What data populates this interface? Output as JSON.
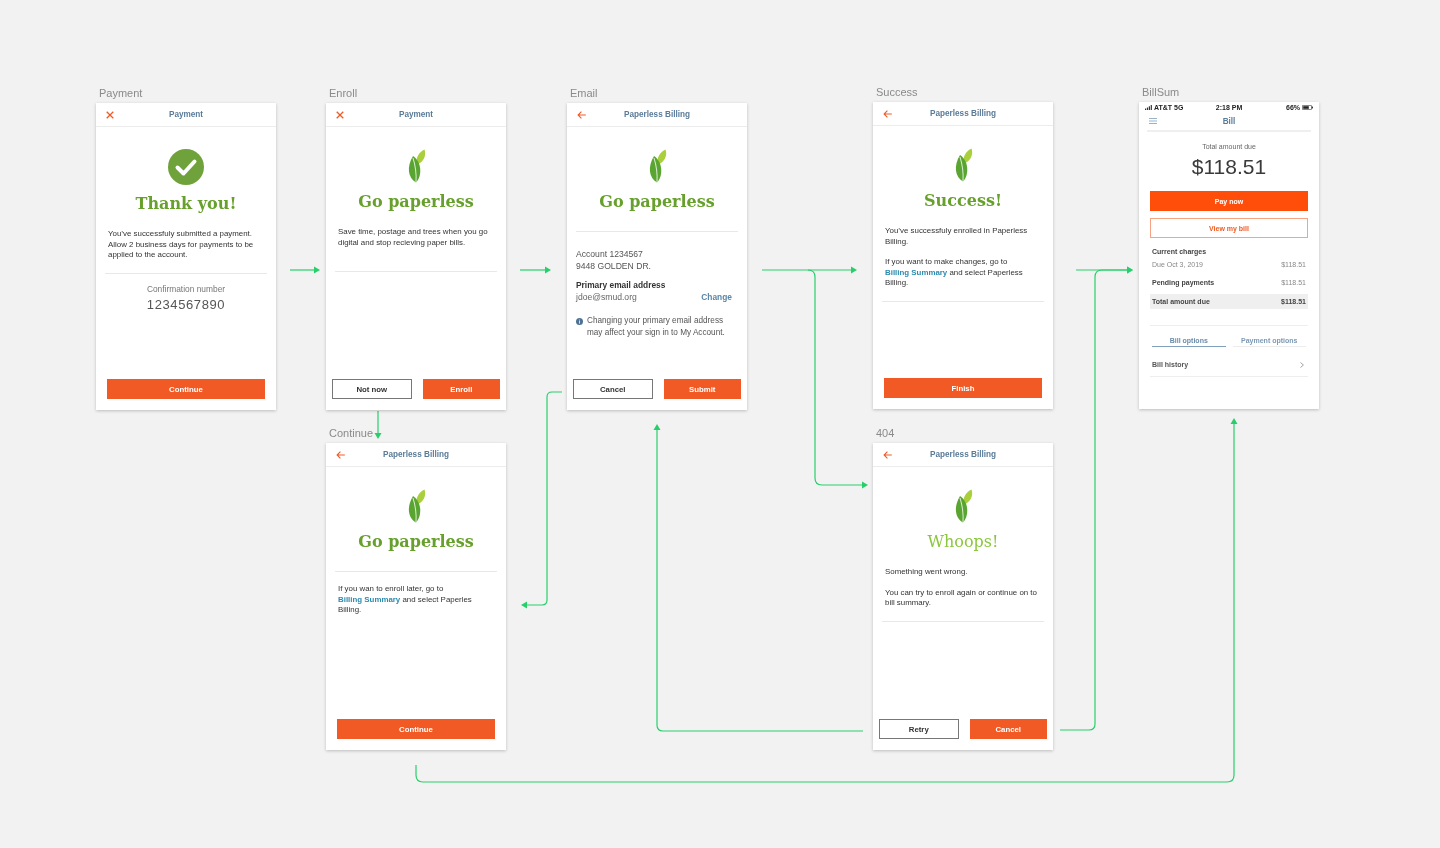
{
  "screens": [
    {
      "label": "Payment",
      "kind": "flow",
      "nav": {
        "kind": "close",
        "title": "Payment"
      },
      "hero": {
        "kind": "confirmation",
        "heading": "Thank you!",
        "error": false
      },
      "top": [
        {
          "kind": "paragraph",
          "text": "You’ve successfuly submitted a payment. Allow 2 business days for payments to be applied to the account."
        }
      ],
      "bottom": [
        {
          "kind": "stat",
          "label": "Confirmation number",
          "value": "1234567890"
        }
      ],
      "buttons": [
        {
          "label": "Continue",
          "kind": "primary"
        }
      ]
    },
    {
      "label": "Enroll",
      "kind": "flow",
      "nav": {
        "kind": "close",
        "title": "Payment"
      },
      "hero": {
        "kind": "brand",
        "heading": "Go paperless",
        "error": false
      },
      "top": [
        {
          "kind": "paragraph",
          "text": "Save time, postage and trees when you go digital and stop recieving paper bills."
        }
      ],
      "buttons": [
        {
          "label": "Not now",
          "kind": "secondary"
        },
        {
          "label": "Enroll",
          "kind": "primary"
        }
      ]
    },
    {
      "label": "Email",
      "kind": "flow",
      "nav": {
        "kind": "back",
        "title": "Paperless Billing"
      },
      "hero": {
        "kind": "brand",
        "heading": "Go paperless",
        "error": false
      },
      "bottom": [
        {
          "kind": "lines",
          "lines": [
            "Account 1234567",
            "9448 GOLDEN DR."
          ]
        },
        {
          "kind": "field",
          "label": "Primary email address",
          "value": "jdoe@smud.org",
          "action": "Change"
        },
        {
          "kind": "note",
          "text": "Changing your primary email address may affect your sign in to My Account."
        }
      ],
      "buttons": [
        {
          "label": "Cancel",
          "kind": "secondary"
        },
        {
          "label": "Submit",
          "kind": "primary"
        }
      ]
    },
    {
      "label": "Success",
      "kind": "flow",
      "nav": {
        "kind": "back",
        "title": "Paperless Billing"
      },
      "hero": {
        "kind": "brand",
        "heading": "Success!",
        "error": false
      },
      "top": [
        {
          "kind": "paragraph",
          "text": "You’ve successfuly enrolled in Paperless Billing."
        },
        {
          "kind": "link_paragraph",
          "before": "If you want to make changes, go to ",
          "link": "Billing Summary",
          "after": " and select Paperless Billing."
        }
      ],
      "buttons": [
        {
          "label": "Finish",
          "kind": "primary"
        }
      ]
    },
    {
      "label": "BillSum",
      "kind": "bill",
      "status_bar": {
        "carrier": "AT&T 5G",
        "time": "2:18 PM",
        "battery": "66%"
      },
      "nav": {
        "kind": "menu",
        "title": "Bill"
      },
      "amount_label": "Total amount due",
      "amount": "$118.51",
      "buttons": [
        {
          "label": "Pay now",
          "kind": "primary"
        },
        {
          "label": "View my bill",
          "kind": "outline"
        }
      ],
      "charges": [
        {
          "kind": "heading",
          "label": "Current charges"
        },
        {
          "kind": "detail",
          "label": "Due Oct 3, 2019",
          "value": "$118.51"
        },
        {
          "kind": "item",
          "label": "Pending payments",
          "value": "$118.51"
        },
        {
          "kind": "total",
          "label": "Total amount due",
          "value": "$118.51"
        }
      ],
      "tabs": [
        {
          "label": "Bill options",
          "selected": true
        },
        {
          "label": "Payment options",
          "selected": false
        }
      ],
      "menu": [
        {
          "label": "Bill history"
        }
      ]
    },
    {
      "label": "Continue",
      "kind": "flow",
      "nav": {
        "kind": "back",
        "title": "Paperless Billing"
      },
      "hero": {
        "kind": "brand",
        "heading": "Go paperless",
        "error": false
      },
      "bottom": [
        {
          "kind": "link_paragraph",
          "before": "If you wan to enroll later, go to ",
          "link": "Billing Summary",
          "after": " and select Paperles Billing."
        }
      ],
      "buttons": [
        {
          "label": "Continue",
          "kind": "primary"
        }
      ]
    },
    {
      "label": "404",
      "kind": "flow",
      "nav": {
        "kind": "back",
        "title": "Paperless Billing"
      },
      "hero": {
        "kind": "brand",
        "heading": "Whoops!",
        "error": true
      },
      "top": [
        {
          "kind": "paragraph",
          "text": "Something went wrong."
        },
        {
          "kind": "paragraph",
          "text": "You can try to enroll again or continue on to bill summary."
        }
      ],
      "buttons": [
        {
          "label": "Retry",
          "kind": "secondary"
        },
        {
          "label": "Cancel",
          "kind": "primary"
        }
      ]
    }
  ]
}
